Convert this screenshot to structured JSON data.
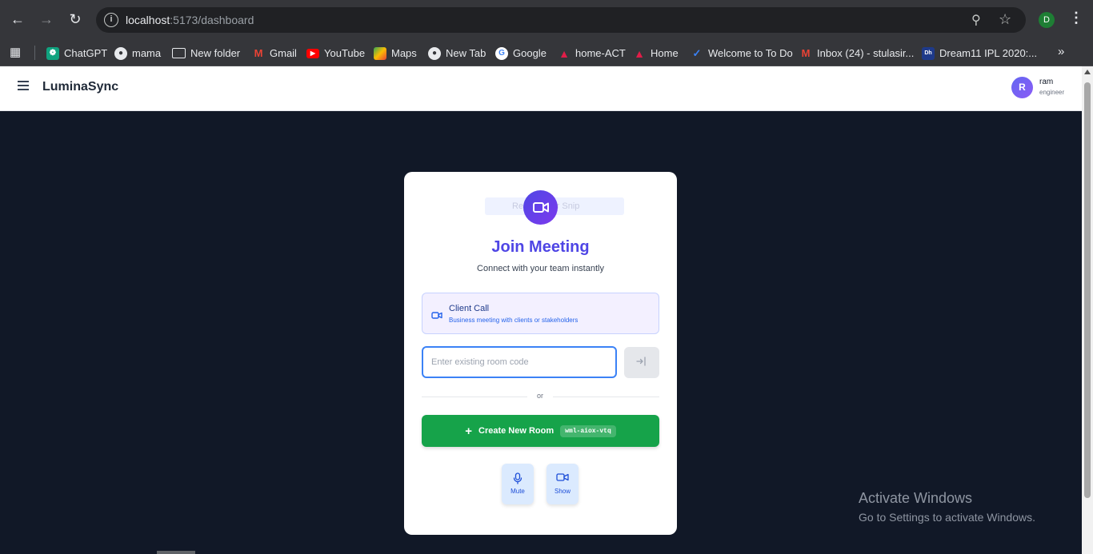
{
  "browser": {
    "url_host": "localhost",
    "url_path": ":5173/dashboard",
    "profile_initial": "D",
    "bookmarks": [
      {
        "label": "ChatGPT",
        "icon": "chatgpt-icon",
        "color": "#10a37f"
      },
      {
        "label": "mama",
        "icon": "globe-icon",
        "color": "#e8eaed"
      },
      {
        "label": "New folder",
        "icon": "folder-icon",
        "color": "#e8eaed"
      },
      {
        "label": "Gmail",
        "icon": "gmail-icon",
        "color": "#ea4335"
      },
      {
        "label": "YouTube",
        "icon": "youtube-icon",
        "color": "#ff0000"
      },
      {
        "label": "Maps",
        "icon": "maps-icon",
        "color": "#34a853"
      },
      {
        "label": "New Tab",
        "icon": "globe-icon",
        "color": "#e8eaed"
      },
      {
        "label": "Google",
        "icon": "google-icon",
        "color": "#4285f4"
      },
      {
        "label": "home-ACT",
        "icon": "act-icon",
        "color": "#e11d48"
      },
      {
        "label": "Home",
        "icon": "act-icon",
        "color": "#e11d48"
      },
      {
        "label": "Welcome to To Do",
        "icon": "todo-icon",
        "color": "#3b82f6"
      },
      {
        "label": "Inbox (24) - stulasir...",
        "icon": "gmail-icon",
        "color": "#ea4335"
      },
      {
        "label": "Dream11 IPL 2020:...",
        "icon": "dream11-icon",
        "color": "#1e3a8a"
      }
    ]
  },
  "app": {
    "brand": "LuminaSync",
    "user": {
      "initial": "R",
      "name": "ram",
      "role": "engineer"
    }
  },
  "card": {
    "ghost_snip": "Rectangular Snip",
    "title": "Join Meeting",
    "subtitle": "Connect with your team instantly",
    "meeting_type": {
      "title": "Client Call",
      "description": "Business meeting with clients or stakeholders"
    },
    "room_input": {
      "placeholder": "Enter existing room code",
      "value": ""
    },
    "divider": "or",
    "create": {
      "label": "Create New Room",
      "code": "wml-aiox-vtq"
    },
    "controls": {
      "mute": "Mute",
      "show": "Show"
    }
  },
  "os": {
    "activate_title": "Activate Windows",
    "activate_sub": "Go to Settings to activate Windows."
  },
  "colors": {
    "accent": "#4f46e5",
    "create": "#16a34a",
    "input_focus": "#3b82f6",
    "background": "#111827"
  }
}
